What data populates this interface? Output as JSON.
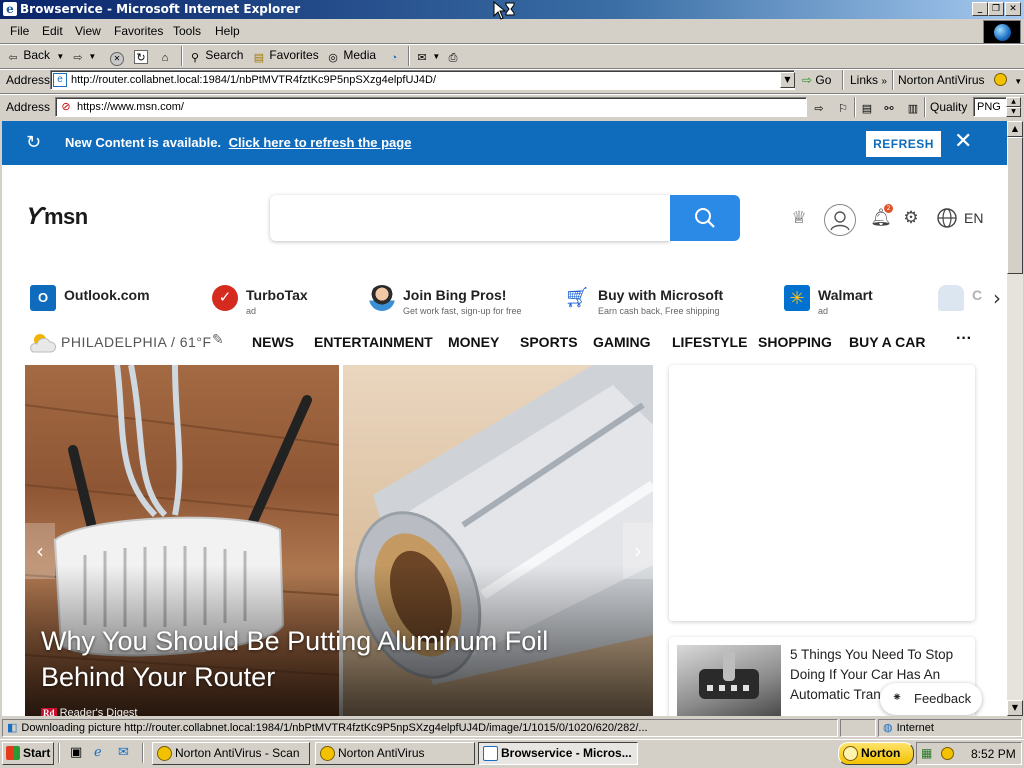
{
  "window": {
    "title": "Browservice - Microsoft Internet Explorer",
    "app_icon": "e"
  },
  "menu": [
    "File",
    "Edit",
    "View",
    "Favorites",
    "Tools",
    "Help"
  ],
  "toolbar": {
    "back": "Back",
    "search": "Search",
    "favorites": "Favorites",
    "media": "Media"
  },
  "ie_address": {
    "label": "Address",
    "url": "http://router.collabnet.local:1984/1/nbPtMVTR4fztKc9P5npSXzg4elpfUJ4D/",
    "go": "Go",
    "links": "Links",
    "links_chevron": "»",
    "norton": "Norton AntiVirus"
  },
  "bs_address": {
    "label": "Address",
    "url": "https://www.msn.com/",
    "quality_label": "Quality",
    "quality_value": "PNG"
  },
  "banner": {
    "message": "New Content is available.",
    "link": "Click here to refresh the page",
    "refresh": "REFRESH",
    "bg": "#0f6cbd"
  },
  "msn": {
    "logo_text": "msn",
    "language": "EN",
    "notification_count": "2",
    "quicklinks": [
      {
        "title": "Outlook.com",
        "sub": ""
      },
      {
        "title": "TurboTax",
        "sub": "ad"
      },
      {
        "title": "Join Bing Pros!",
        "sub": "Get work fast, sign-up for free"
      },
      {
        "title": "Buy with Microsoft",
        "sub": "Earn cash back, Free shipping"
      },
      {
        "title": "Walmart",
        "sub": "ad"
      },
      {
        "title": "C",
        "sub": ""
      }
    ],
    "weather": "PHILADELPHIA / 61°F",
    "nav": [
      "NEWS",
      "ENTERTAINMENT",
      "MONEY",
      "SPORTS",
      "GAMING",
      "LIFESTYLE",
      "SHOPPING",
      "BUY A CAR"
    ],
    "more": "···",
    "hero": {
      "title": "Why You Should Be Putting Aluminum Foil Behind Your Router",
      "source": "Reader's Digest",
      "source_badge": "Rd"
    },
    "story2": {
      "title": "5 Things You Need To Stop Doing If Your Car Has An Automatic Trans..."
    },
    "feedback": "Feedback"
  },
  "status": {
    "text": "Downloading picture http://router.collabnet.local:1984/1/nbPtMVTR4fztKc9P5npSXzg4elpfUJ4D/image/1/1015/0/1020/620/282/...",
    "zone": "Internet"
  },
  "taskbar": {
    "start": "Start",
    "tasks": [
      "Norton AntiVirus - Scan",
      "Norton AntiVirus",
      "Browservice - Micros..."
    ],
    "norton_tray": "Norton",
    "clock": "8:52 PM"
  }
}
